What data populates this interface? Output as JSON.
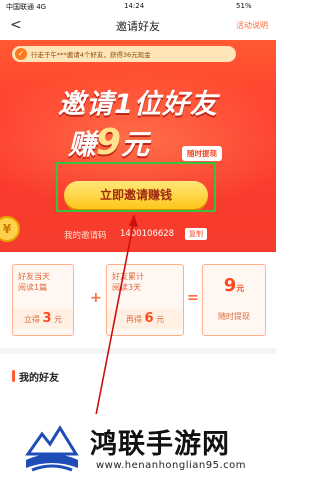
{
  "status_bar": {
    "carrier": "中国联通 4G",
    "time": "14:24",
    "battery": "51%"
  },
  "nav": {
    "back_glyph": "<",
    "title": "邀请好友",
    "action": "活动说明"
  },
  "notice": {
    "icon": "✓",
    "text": "行走于午***邀请4个好友，获得36元现金"
  },
  "hero": {
    "headline": "邀请1位好友",
    "earn_prefix": "赚",
    "earn_amount": "9",
    "earn_suffix": "元",
    "tag": "随时提现",
    "invite_button": "立即邀请赚钱",
    "code_label": "我的邀请码",
    "code_value": "1400106628",
    "copy_label": "复制",
    "coin_glyph": "¥"
  },
  "steps": {
    "card1": {
      "text": "好友当天\n阅读1篇",
      "reward_prefix": "立得",
      "reward_amount": "3",
      "reward_unit": "元"
    },
    "op_plus": "+",
    "card2": {
      "text": "好友累计\n阅读3天",
      "reward_prefix": "再得",
      "reward_amount": "6",
      "reward_unit": "元"
    },
    "op_equals": "=",
    "result": {
      "amount": "9",
      "unit": "元",
      "desc": "随时提现"
    }
  },
  "friends": {
    "title": "我的好友"
  },
  "watermark": {
    "title": "鸿联手游网",
    "url": "www.henanhonglian95.com"
  },
  "colors": {
    "accent": "#ff5a32",
    "button": "#ffc61a",
    "highlight": "#39c23e",
    "arrow": "#cc1111"
  }
}
